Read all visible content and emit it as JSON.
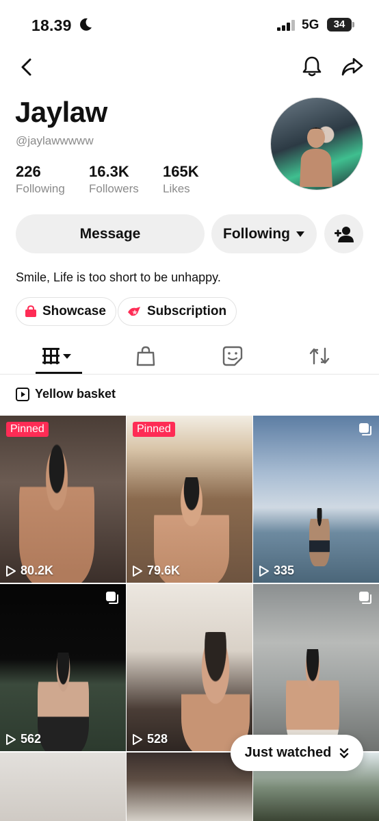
{
  "status_bar": {
    "time": "18.39",
    "network": "5G",
    "battery": "34"
  },
  "profile": {
    "display_name": "Jaylaw",
    "username": "@jaylawwwww",
    "stats": [
      {
        "value": "226",
        "label": "Following"
      },
      {
        "value": "16.3K",
        "label": "Followers"
      },
      {
        "value": "165K",
        "label": "Likes"
      }
    ],
    "bio": "Smile, Life is too short to be unhappy."
  },
  "actions": {
    "message_label": "Message",
    "following_label": "Following"
  },
  "chips": [
    {
      "label": "Showcase",
      "icon": "shopping-bag-icon"
    },
    {
      "label": "Subscription",
      "icon": "subscription-icon"
    }
  ],
  "tabs": [
    {
      "name": "videos",
      "icon": "grid-icon",
      "active": true
    },
    {
      "name": "shop",
      "icon": "shopping-bag-icon",
      "active": false
    },
    {
      "name": "stickers",
      "icon": "sticker-icon",
      "active": false
    },
    {
      "name": "reposts",
      "icon": "repost-icon",
      "active": false
    }
  ],
  "section": {
    "label": "Yellow basket"
  },
  "videos": [
    {
      "views": "80.2K",
      "pinned": true,
      "pinned_label": "Pinned",
      "multi": false
    },
    {
      "views": "79.6K",
      "pinned": true,
      "pinned_label": "Pinned",
      "multi": false
    },
    {
      "views": "335",
      "pinned": false,
      "multi": true
    },
    {
      "views": "562",
      "pinned": false,
      "multi": true
    },
    {
      "views": "528",
      "pinned": false,
      "multi": false
    },
    {
      "views": "",
      "pinned": false,
      "multi": true
    },
    {
      "views": "",
      "pinned": false,
      "multi": false
    },
    {
      "views": "",
      "pinned": false,
      "multi": false
    },
    {
      "views": "",
      "pinned": false,
      "multi": false
    }
  ],
  "floating": {
    "just_watched_label": "Just watched"
  },
  "colors": {
    "accent": "#fe2c55",
    "button_bg": "#efefef",
    "muted_text": "#8a8a8a"
  }
}
